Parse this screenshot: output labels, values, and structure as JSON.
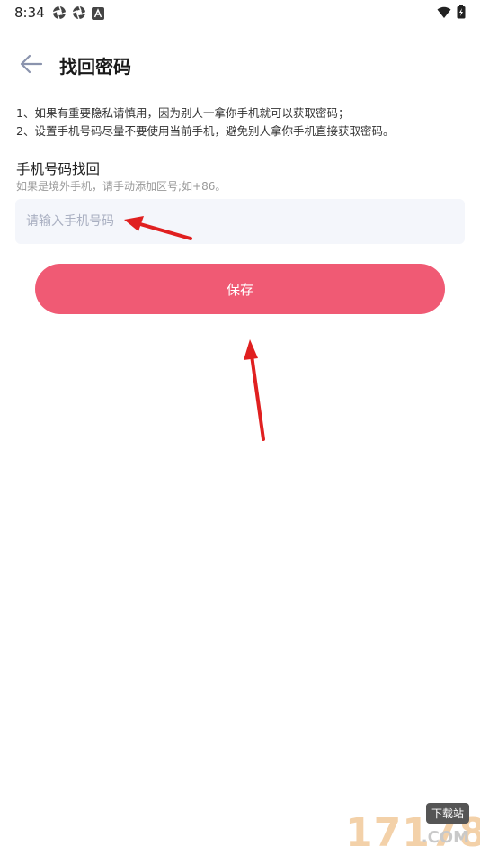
{
  "status_bar": {
    "time": "8:34"
  },
  "header": {
    "title": "找回密码"
  },
  "notes": {
    "line1": "1、如果有重要隐私请慎用，因为别人一拿你手机就可以获取密码；",
    "line2": "2、设置手机号码尽量不要使用当前手机，避免别人拿你手机直接获取密码。"
  },
  "phone_section": {
    "title": "手机号码找回",
    "hint": "如果是境外手机，请手动添加区号;如+86。",
    "input_placeholder": "请输入手机号码",
    "input_value": ""
  },
  "actions": {
    "save_label": "保存"
  },
  "watermark": {
    "digits": "17178",
    "badge": "下载站",
    "suffix": ".COM"
  },
  "colors": {
    "accent": "#f05a74",
    "arrow": "#e02020",
    "input_bg": "#f4f6fb"
  }
}
